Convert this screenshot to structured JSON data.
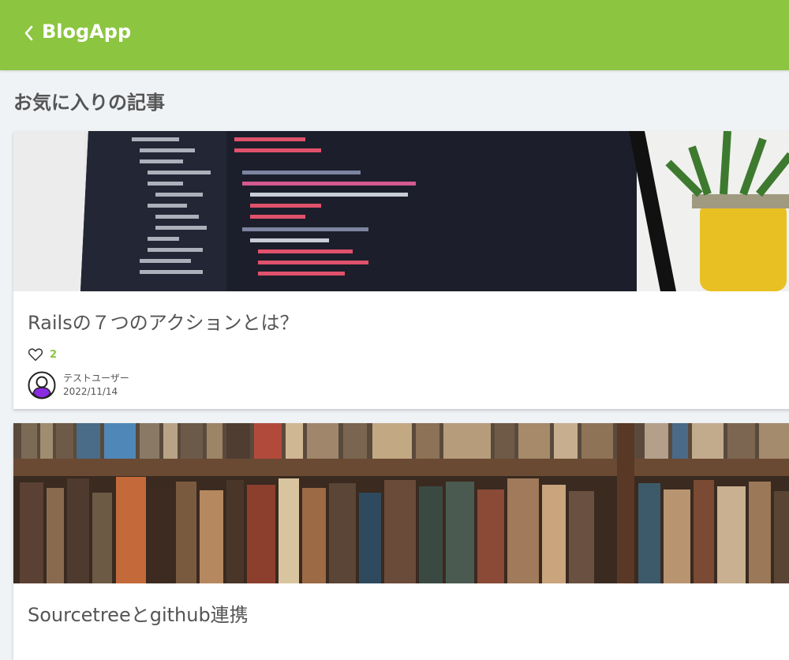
{
  "header": {
    "title": "BlogApp",
    "back_icon": "chevron-left-icon"
  },
  "page": {
    "title": "お気に入りの記事"
  },
  "posts": [
    {
      "title": "Railsの７つのアクションとは？",
      "likes": "2",
      "author": "テストユーザー",
      "date": "2022/11/14",
      "thumbnail": "code-editor-laptop-image"
    },
    {
      "title": "Sourcetreeとgithub連携",
      "thumbnail": "bookshelf-image"
    }
  ],
  "colors": {
    "accent": "#8cc540",
    "text": "#555555",
    "background": "#f0f3f6"
  }
}
